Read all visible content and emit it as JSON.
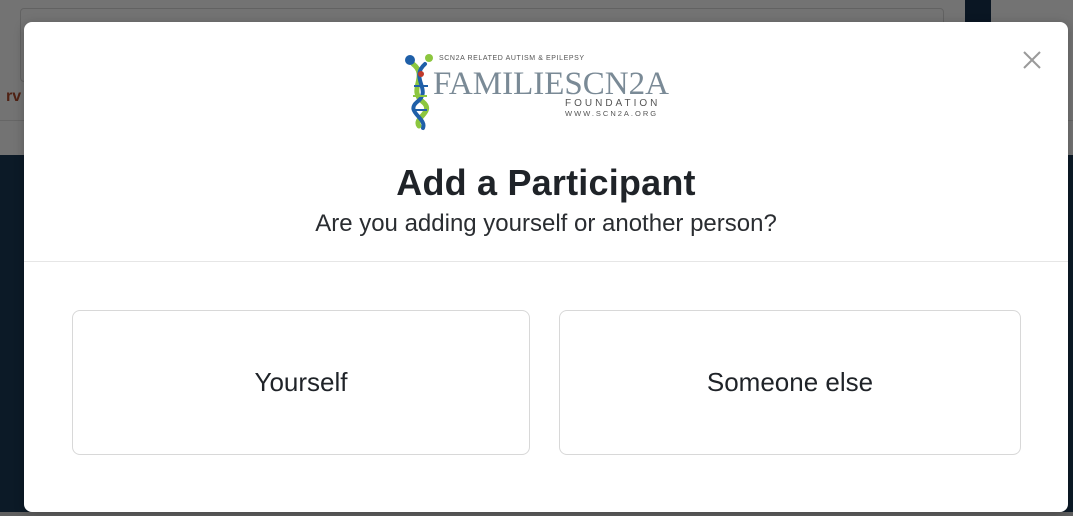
{
  "background": {
    "fragment_text": "rv"
  },
  "modal": {
    "logo": {
      "tagline": "SCN2A RELATED AUTISM & EPILEPSY",
      "brand": "FAMILIESCN2A",
      "foundation": "FOUNDATION",
      "url": "WWW.SCN2A.ORG",
      "brand_color": "#7a8a96",
      "accent_green": "#8cc63f",
      "accent_blue": "#1f5fa8",
      "accent_red": "#c0392b"
    },
    "title": "Add a Participant",
    "subtitle": "Are you adding yourself or another person?",
    "options": [
      {
        "label": "Yourself"
      },
      {
        "label": "Someone else"
      }
    ]
  }
}
